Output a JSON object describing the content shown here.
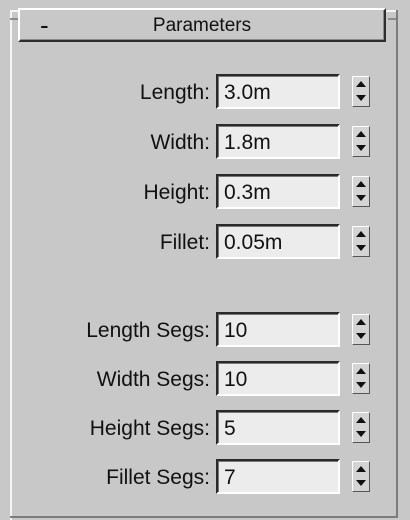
{
  "rollout": {
    "collapse_symbol": "-",
    "title": "Parameters"
  },
  "parameters": [
    {
      "label": "Length:",
      "value": "3.0m"
    },
    {
      "label": "Width:",
      "value": "1.8m"
    },
    {
      "label": "Height:",
      "value": "0.3m"
    },
    {
      "label": "Fillet:",
      "value": "0.05m"
    },
    {
      "label": "Length Segs:",
      "value": "10"
    },
    {
      "label": "Width Segs:",
      "value": "10"
    },
    {
      "label": "Height Segs:",
      "value": "5"
    },
    {
      "label": "Fillet Segs:",
      "value": "7"
    }
  ],
  "icons": {
    "spinner_up": "spinner-up-arrow-icon",
    "spinner_down": "spinner-down-arrow-icon"
  },
  "colors": {
    "panel_background": "#c8c8c8",
    "field_background": "#ececec",
    "text": "#111111"
  }
}
